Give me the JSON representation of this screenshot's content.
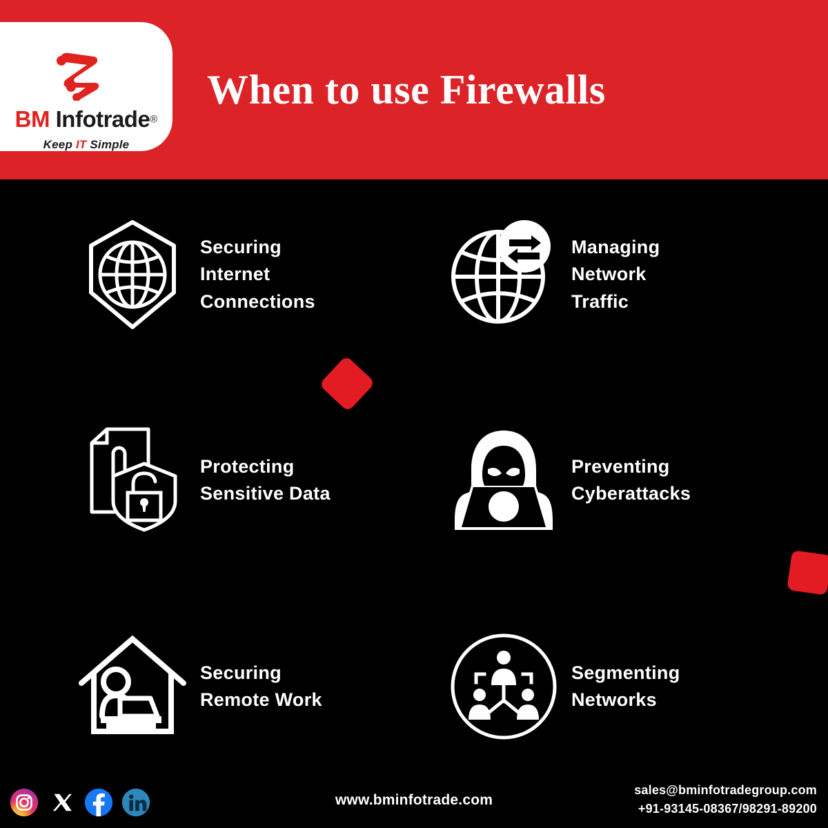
{
  "brand": {
    "name_first": "BM",
    "name_second": "Infotrade",
    "registered_mark": "®",
    "tagline_pre": "Keep ",
    "tagline_accent": "IT",
    "tagline_post": " Simple",
    "logo_icon": "bm-lightning-logo-icon",
    "red": "#DC2328",
    "card_bg": "#FFFFFF"
  },
  "header": {
    "title": "When to use Firewalls",
    "background": "#DC2328"
  },
  "decor": [
    {
      "name": "red-diamond-decoration",
      "color": "#E31C24"
    },
    {
      "name": "red-square-decoration",
      "color": "#E31C24"
    }
  ],
  "features": [
    {
      "icon": "shield-globe-icon",
      "label": "Securing\nInternet\nConnections"
    },
    {
      "icon": "globe-transfer-arrows-icon",
      "label": "Managing\nNetwork\nTraffic"
    },
    {
      "icon": "document-alert-lock-shield-icon",
      "label": "Protecting\nSensitive Data"
    },
    {
      "icon": "hacker-laptop-icon",
      "label": "Preventing\nCyberattacks"
    },
    {
      "icon": "house-remote-worker-icon",
      "label": "Securing\nRemote Work"
    },
    {
      "icon": "network-segmentation-icon",
      "label": "Segmenting\nNetworks"
    }
  ],
  "footer": {
    "website": "www.bminfotrade.com",
    "email": "sales@bminfotradegroup.com",
    "phone": "+91-93145-08367/98291-89200",
    "social": [
      {
        "name": "instagram-icon",
        "color": "#E1306C"
      },
      {
        "name": "x-twitter-icon",
        "color": "#FFFFFF"
      },
      {
        "name": "facebook-icon",
        "color": "#1877F2"
      },
      {
        "name": "linkedin-icon",
        "color": "#2E87BB"
      }
    ]
  }
}
